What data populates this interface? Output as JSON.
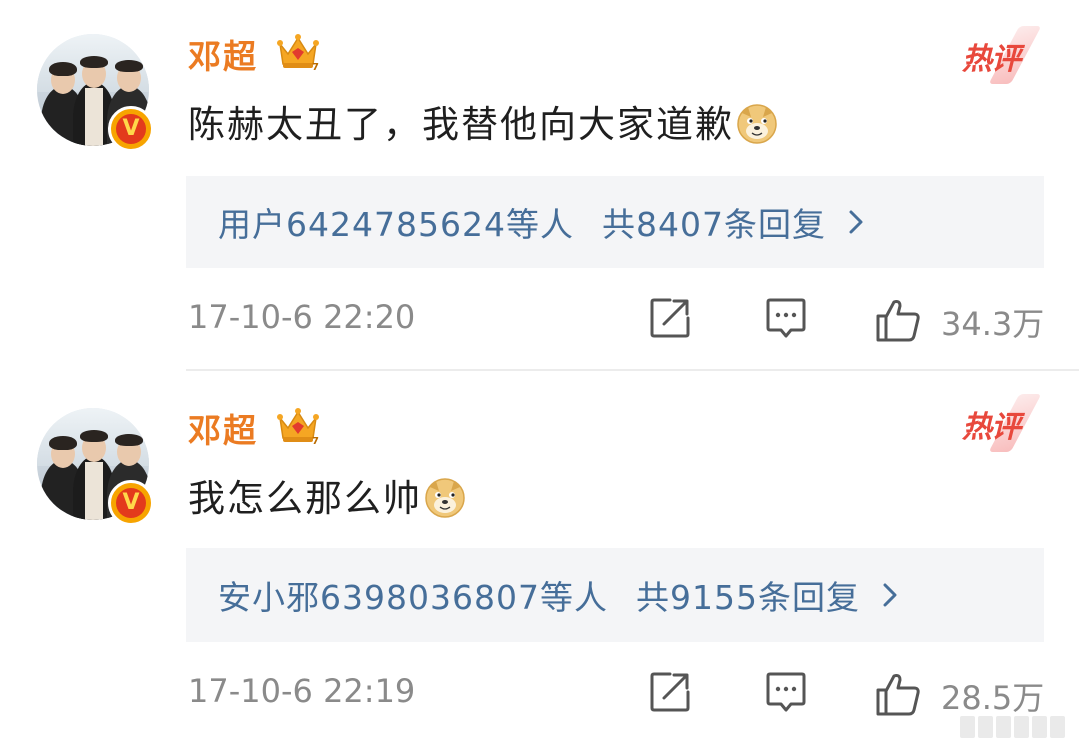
{
  "comments": [
    {
      "username": "邓超",
      "hot_badge": "热评",
      "text": "陈赫太丑了，我替他向大家道歉",
      "emoji": "doge-emoji",
      "reply_who": "用户6424785624等人",
      "reply_total": "共8407条回复",
      "timestamp": "17-10-6 22:20",
      "likes": "34.3万"
    },
    {
      "username": "邓超",
      "hot_badge": "热评",
      "text": "我怎么那么帅",
      "emoji": "doge-emoji",
      "reply_who": "安小邪6398036807等人",
      "reply_total": "共9155条回复",
      "timestamp": "17-10-6 22:19",
      "likes": "28.5万"
    }
  ],
  "icons": {
    "crown": "crown-icon",
    "share": "share-icon",
    "comment": "comment-icon",
    "like": "thumbs-up-icon",
    "chevron": "chevron-right-icon",
    "verified": "verified-badge-icon"
  },
  "colors": {
    "username": "#eb7b22",
    "reply_link": "#466e99",
    "hot_badge": "#e8483c",
    "muted": "#8a8a8a",
    "reply_bg": "#f4f5f7",
    "verified_outer": "#f7a400",
    "verified_inner": "#e33a1c"
  }
}
